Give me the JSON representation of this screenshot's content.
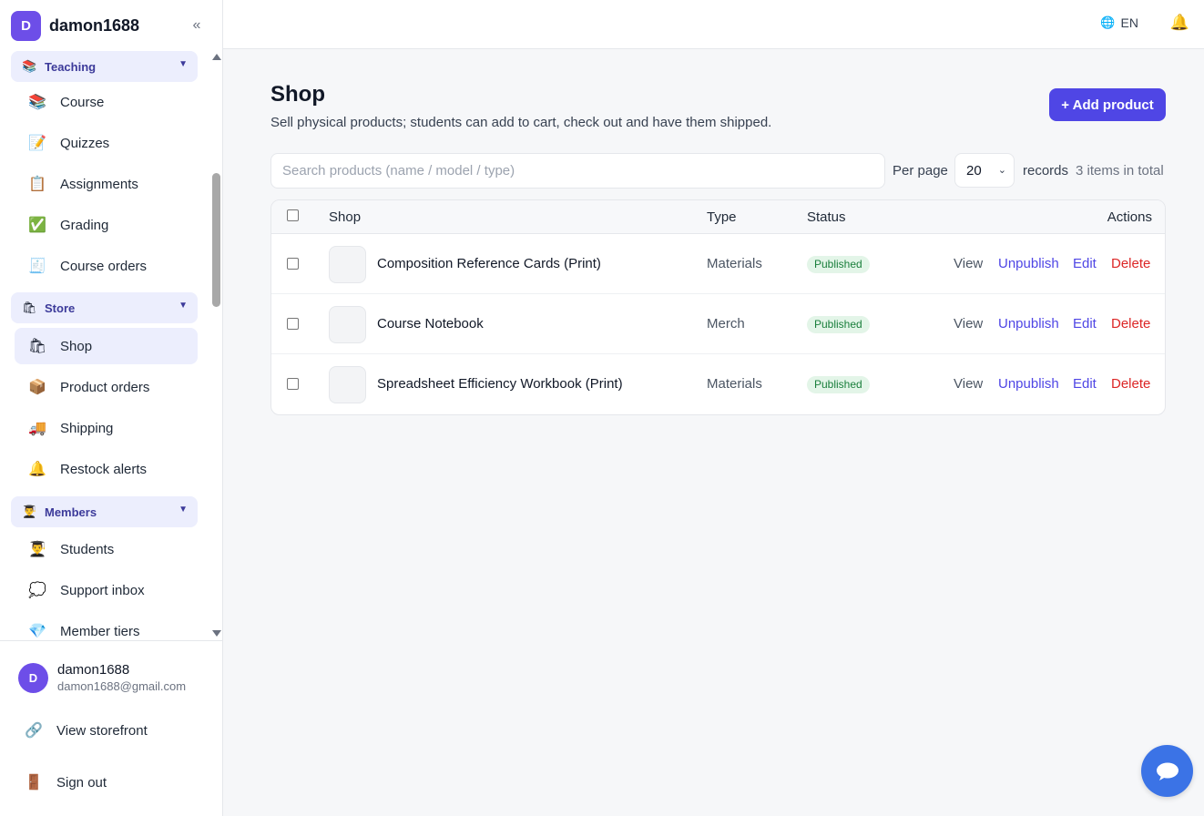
{
  "brand": {
    "initial": "D",
    "name": "damon1688",
    "collapse_icon": "«"
  },
  "sidebar": {
    "sections": [
      {
        "label": "Teaching",
        "icon": "books-icon",
        "glyph": "📚",
        "caret": "▼"
      },
      {
        "label": "Store",
        "icon": "shopping-bag-icon",
        "glyph": "🛍",
        "caret": "▼"
      },
      {
        "label": "Members",
        "icon": "student-icon",
        "glyph": "👨‍🎓",
        "caret": "▼"
      }
    ],
    "items": [
      {
        "label": "Course",
        "glyph": "📚"
      },
      {
        "label": "Quizzes",
        "glyph": "📝"
      },
      {
        "label": "Assignments",
        "glyph": "📋"
      },
      {
        "label": "Grading",
        "glyph": "✅"
      },
      {
        "label": "Course orders",
        "glyph": "🧾"
      },
      {
        "label": "Shop",
        "glyph": "🛍",
        "active": true
      },
      {
        "label": "Product orders",
        "glyph": "📦"
      },
      {
        "label": "Shipping",
        "glyph": "🚚"
      },
      {
        "label": "Restock alerts",
        "glyph": "🔔"
      },
      {
        "label": "Students",
        "glyph": "👨‍🎓"
      },
      {
        "label": "Support inbox",
        "glyph": "💭"
      },
      {
        "label": "Member tiers",
        "glyph": "💎"
      }
    ]
  },
  "user": {
    "initial": "D",
    "name": "damon1688",
    "email": "damon1688@gmail.com"
  },
  "footer_links": [
    {
      "label": "View storefront",
      "glyph": "🔗"
    },
    {
      "label": "Sign out",
      "glyph": "🚪"
    }
  ],
  "topbar": {
    "lang": "EN",
    "globe": "🌐",
    "bell": "🔔"
  },
  "page": {
    "title": "Shop",
    "subtitle": "Sell physical products; students can add to cart, check out and have them shipped.",
    "add_button": "+ Add product"
  },
  "filters": {
    "search_placeholder": "Search products (name / model / type)",
    "per_page_label": "Per page",
    "per_page_value": "20",
    "records_label": "records",
    "total_label": "3 items in total"
  },
  "table": {
    "headers": {
      "shop": "Shop",
      "type": "Type",
      "status": "Status",
      "actions": "Actions"
    },
    "rows": [
      {
        "name": "Composition Reference Cards (Print)",
        "type": "Materials",
        "status": "Published"
      },
      {
        "name": "Course Notebook",
        "type": "Merch",
        "status": "Published"
      },
      {
        "name": "Spreadsheet Efficiency Workbook (Print)",
        "type": "Materials",
        "status": "Published"
      }
    ],
    "actions": {
      "view": "View",
      "unpublish": "Unpublish",
      "edit": "Edit",
      "delete": "Delete"
    }
  },
  "colors": {
    "accent": "#4f46e5",
    "brand": "#6d4ee8",
    "danger": "#dc2626",
    "success_bg": "#e3f5e8",
    "chat": "#3b73e6"
  }
}
